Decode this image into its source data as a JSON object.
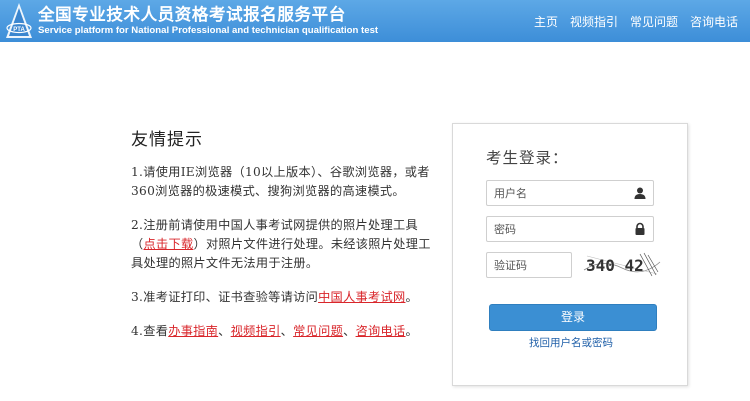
{
  "header": {
    "title_cn": "全国专业技术人员资格考试报名服务平台",
    "title_en": "Service platform for National Professional and technician qualification test",
    "logo_text": "PTA",
    "nav": [
      "主页",
      "视频指引",
      "常见问题",
      "咨询电话"
    ],
    "bg_color": "#4a9ae0"
  },
  "notice": {
    "title": "友情提示",
    "p1": {
      "text_a": "1.请使用IE浏览器（10以上版本）、谷歌浏览器，或者360浏览器的极速模式、搜狗浏览器的高速模式。"
    },
    "p2": {
      "text_a": "2.注册前请使用中国人事考试网提供的照片处理工具（",
      "link": "点击下载",
      "text_b": "）对照片文件进行处理。未经该照片处理工具处理的照片文件无法用于注册。"
    },
    "p3": {
      "text_a": "3.准考证打印、证书查验等请访问",
      "link": "中国人事考试网",
      "text_b": "。"
    },
    "p4": {
      "text_a": "4.查看",
      "link1": "办事指南",
      "sep1": "、",
      "link2": "视频指引",
      "sep2": "、",
      "link3": "常见问题",
      "sep3": "、",
      "link4": "咨询电话",
      "end": "。"
    },
    "link_color": "#d9262b"
  },
  "login": {
    "title": "考生登录：",
    "username_placeholder": "用户名",
    "password_placeholder": "密码",
    "code_placeholder": "验证码",
    "captcha_text": "340 42",
    "login_button": "登录",
    "find_link": "找回用户名或密码",
    "button_color": "#3b8fd3"
  }
}
